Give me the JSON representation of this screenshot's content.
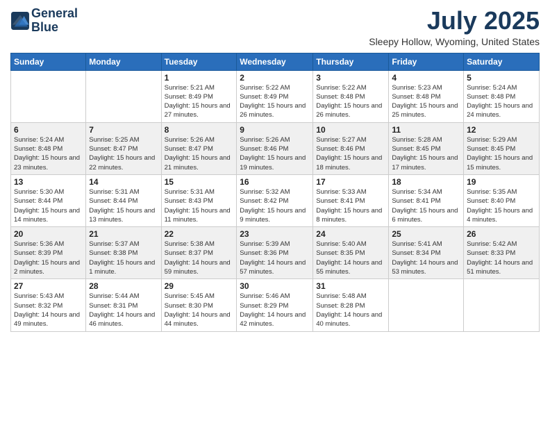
{
  "logo": {
    "line1": "General",
    "line2": "Blue"
  },
  "title": "July 2025",
  "location": "Sleepy Hollow, Wyoming, United States",
  "days_of_week": [
    "Sunday",
    "Monday",
    "Tuesday",
    "Wednesday",
    "Thursday",
    "Friday",
    "Saturday"
  ],
  "weeks": [
    [
      {
        "day": "",
        "sunrise": "",
        "sunset": "",
        "daylight": ""
      },
      {
        "day": "",
        "sunrise": "",
        "sunset": "",
        "daylight": ""
      },
      {
        "day": "1",
        "sunrise": "Sunrise: 5:21 AM",
        "sunset": "Sunset: 8:49 PM",
        "daylight": "Daylight: 15 hours and 27 minutes."
      },
      {
        "day": "2",
        "sunrise": "Sunrise: 5:22 AM",
        "sunset": "Sunset: 8:49 PM",
        "daylight": "Daylight: 15 hours and 26 minutes."
      },
      {
        "day": "3",
        "sunrise": "Sunrise: 5:22 AM",
        "sunset": "Sunset: 8:48 PM",
        "daylight": "Daylight: 15 hours and 26 minutes."
      },
      {
        "day": "4",
        "sunrise": "Sunrise: 5:23 AM",
        "sunset": "Sunset: 8:48 PM",
        "daylight": "Daylight: 15 hours and 25 minutes."
      },
      {
        "day": "5",
        "sunrise": "Sunrise: 5:24 AM",
        "sunset": "Sunset: 8:48 PM",
        "daylight": "Daylight: 15 hours and 24 minutes."
      }
    ],
    [
      {
        "day": "6",
        "sunrise": "Sunrise: 5:24 AM",
        "sunset": "Sunset: 8:48 PM",
        "daylight": "Daylight: 15 hours and 23 minutes."
      },
      {
        "day": "7",
        "sunrise": "Sunrise: 5:25 AM",
        "sunset": "Sunset: 8:47 PM",
        "daylight": "Daylight: 15 hours and 22 minutes."
      },
      {
        "day": "8",
        "sunrise": "Sunrise: 5:26 AM",
        "sunset": "Sunset: 8:47 PM",
        "daylight": "Daylight: 15 hours and 21 minutes."
      },
      {
        "day": "9",
        "sunrise": "Sunrise: 5:26 AM",
        "sunset": "Sunset: 8:46 PM",
        "daylight": "Daylight: 15 hours and 19 minutes."
      },
      {
        "day": "10",
        "sunrise": "Sunrise: 5:27 AM",
        "sunset": "Sunset: 8:46 PM",
        "daylight": "Daylight: 15 hours and 18 minutes."
      },
      {
        "day": "11",
        "sunrise": "Sunrise: 5:28 AM",
        "sunset": "Sunset: 8:45 PM",
        "daylight": "Daylight: 15 hours and 17 minutes."
      },
      {
        "day": "12",
        "sunrise": "Sunrise: 5:29 AM",
        "sunset": "Sunset: 8:45 PM",
        "daylight": "Daylight: 15 hours and 15 minutes."
      }
    ],
    [
      {
        "day": "13",
        "sunrise": "Sunrise: 5:30 AM",
        "sunset": "Sunset: 8:44 PM",
        "daylight": "Daylight: 15 hours and 14 minutes."
      },
      {
        "day": "14",
        "sunrise": "Sunrise: 5:31 AM",
        "sunset": "Sunset: 8:44 PM",
        "daylight": "Daylight: 15 hours and 13 minutes."
      },
      {
        "day": "15",
        "sunrise": "Sunrise: 5:31 AM",
        "sunset": "Sunset: 8:43 PM",
        "daylight": "Daylight: 15 hours and 11 minutes."
      },
      {
        "day": "16",
        "sunrise": "Sunrise: 5:32 AM",
        "sunset": "Sunset: 8:42 PM",
        "daylight": "Daylight: 15 hours and 9 minutes."
      },
      {
        "day": "17",
        "sunrise": "Sunrise: 5:33 AM",
        "sunset": "Sunset: 8:41 PM",
        "daylight": "Daylight: 15 hours and 8 minutes."
      },
      {
        "day": "18",
        "sunrise": "Sunrise: 5:34 AM",
        "sunset": "Sunset: 8:41 PM",
        "daylight": "Daylight: 15 hours and 6 minutes."
      },
      {
        "day": "19",
        "sunrise": "Sunrise: 5:35 AM",
        "sunset": "Sunset: 8:40 PM",
        "daylight": "Daylight: 15 hours and 4 minutes."
      }
    ],
    [
      {
        "day": "20",
        "sunrise": "Sunrise: 5:36 AM",
        "sunset": "Sunset: 8:39 PM",
        "daylight": "Daylight: 15 hours and 2 minutes."
      },
      {
        "day": "21",
        "sunrise": "Sunrise: 5:37 AM",
        "sunset": "Sunset: 8:38 PM",
        "daylight": "Daylight: 15 hours and 1 minute."
      },
      {
        "day": "22",
        "sunrise": "Sunrise: 5:38 AM",
        "sunset": "Sunset: 8:37 PM",
        "daylight": "Daylight: 14 hours and 59 minutes."
      },
      {
        "day": "23",
        "sunrise": "Sunrise: 5:39 AM",
        "sunset": "Sunset: 8:36 PM",
        "daylight": "Daylight: 14 hours and 57 minutes."
      },
      {
        "day": "24",
        "sunrise": "Sunrise: 5:40 AM",
        "sunset": "Sunset: 8:35 PM",
        "daylight": "Daylight: 14 hours and 55 minutes."
      },
      {
        "day": "25",
        "sunrise": "Sunrise: 5:41 AM",
        "sunset": "Sunset: 8:34 PM",
        "daylight": "Daylight: 14 hours and 53 minutes."
      },
      {
        "day": "26",
        "sunrise": "Sunrise: 5:42 AM",
        "sunset": "Sunset: 8:33 PM",
        "daylight": "Daylight: 14 hours and 51 minutes."
      }
    ],
    [
      {
        "day": "27",
        "sunrise": "Sunrise: 5:43 AM",
        "sunset": "Sunset: 8:32 PM",
        "daylight": "Daylight: 14 hours and 49 minutes."
      },
      {
        "day": "28",
        "sunrise": "Sunrise: 5:44 AM",
        "sunset": "Sunset: 8:31 PM",
        "daylight": "Daylight: 14 hours and 46 minutes."
      },
      {
        "day": "29",
        "sunrise": "Sunrise: 5:45 AM",
        "sunset": "Sunset: 8:30 PM",
        "daylight": "Daylight: 14 hours and 44 minutes."
      },
      {
        "day": "30",
        "sunrise": "Sunrise: 5:46 AM",
        "sunset": "Sunset: 8:29 PM",
        "daylight": "Daylight: 14 hours and 42 minutes."
      },
      {
        "day": "31",
        "sunrise": "Sunrise: 5:48 AM",
        "sunset": "Sunset: 8:28 PM",
        "daylight": "Daylight: 14 hours and 40 minutes."
      },
      {
        "day": "",
        "sunrise": "",
        "sunset": "",
        "daylight": ""
      },
      {
        "day": "",
        "sunrise": "",
        "sunset": "",
        "daylight": ""
      }
    ]
  ]
}
